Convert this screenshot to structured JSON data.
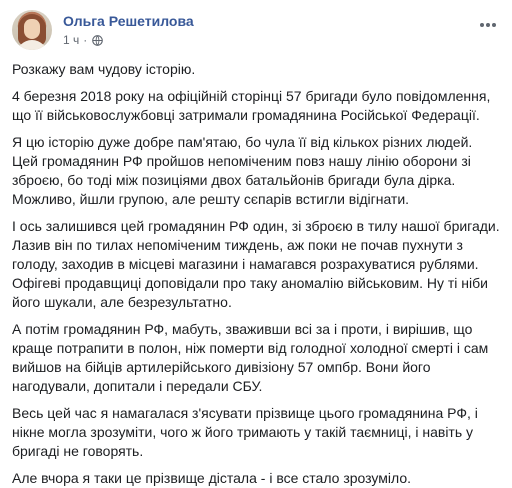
{
  "post": {
    "author": "Ольга Решетилова",
    "time": "1 ч",
    "separator": "·",
    "paragraphs": [
      "Розкажу вам чудову історію.",
      "4 березня 2018 року на офіційній сторінці 57 бригади було повідомлення, що її військовослужбовці затримали громадянина Російської Федерації.",
      "Я цю історію дуже добре пам'ятаю, бо чула її від кількох різних людей. Цей громадянин РФ пройшов непоміченим повз нашу лінію оборони зі зброєю, бо тоді між позиціями двох батальйонів бригади була дірка. Можливо, йшли групою, але решту сєпарів встигли відігнати.",
      "І ось залишився цей громадянин РФ один, зі зброєю в тилу нашої бригади. Лазив він по тилах непоміченим тиждень, аж поки не почав пухнути з голоду, заходив в місцеві магазини і намагався розрахуватися рублями. Офігеві продавщиці доповідали про таку аномалію військовим. Ну ті ніби його шукали, але безрезультатно.",
      "А потім громадянин РФ, мабуть, зваживши всі за і проти, і вирішив, що краще потрапити в полон, ніж померти від голодної холодної смерті і сам вийшов на бійців артилерійського дивізіону 57 омпбр. Вони його нагодували, допитали і передали СБУ.",
      "Весь цей час я намагалася з'ясувати прізвище цього громадянина РФ, і нікне могла зрозуміти, чого ж його тримають у такій таємниці, і навіть у бригаді не говорять.",
      "Але вчора я таки це прізвище дістала - і все стало зрозуміло."
    ]
  },
  "icons": {
    "globe": "globe-icon",
    "more": "more-options-icon",
    "avatar": "profile-avatar"
  },
  "colors": {
    "author": "#385898",
    "meta": "#616770",
    "text": "#1c1e21"
  }
}
